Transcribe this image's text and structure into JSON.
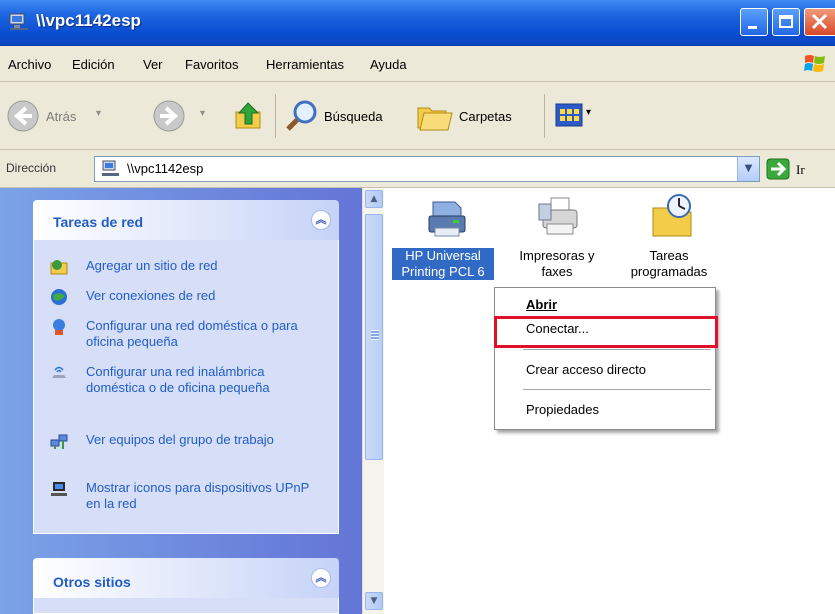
{
  "window": {
    "title": "\\\\vpc1142esp",
    "buttons": {
      "minimize": "_",
      "maximize": "□",
      "close": "✕"
    }
  },
  "menubar": {
    "items": [
      "Archivo",
      "Edición",
      "Ver",
      "Favoritos",
      "Herramientas",
      "Ayuda"
    ]
  },
  "toolbar": {
    "back_label": "Atrás",
    "search_label": "Búsqueda",
    "folders_label": "Carpetas"
  },
  "address": {
    "label": "Dirección",
    "value": "\\\\vpc1142esp",
    "go_label": "Ir"
  },
  "taskpane": {
    "network_tasks": {
      "title": "Tareas de red",
      "items": [
        {
          "label": "Agregar un sitio de red",
          "icon": "add-network-place-icon"
        },
        {
          "label": "Ver conexiones de red",
          "icon": "network-connections-icon"
        },
        {
          "label": "Configurar una red doméstica o para oficina pequeña",
          "icon": "home-network-icon"
        },
        {
          "label": "Configurar una red inalámbrica doméstica o de oficina pequeña",
          "icon": "wireless-network-icon"
        },
        {
          "label": "Ver equipos del grupo de trabajo",
          "icon": "workgroup-icon"
        },
        {
          "label": "Mostrar iconos para dispositivos UPnP en la red",
          "icon": "upnp-icon"
        }
      ]
    },
    "other_places": {
      "title": "Otros sitios"
    }
  },
  "content": {
    "items": [
      {
        "label_line1": "HP Universal",
        "label_line2": "Printing PCL 6",
        "icon": "printer-icon",
        "selected": true
      },
      {
        "label_line1": "Impresoras y",
        "label_line2": "faxes",
        "icon": "printers-faxes-icon",
        "selected": false
      },
      {
        "label_line1": "Tareas",
        "label_line2": "programadas",
        "icon": "scheduled-tasks-icon",
        "selected": false
      }
    ]
  },
  "context_menu": {
    "open": "Abrir",
    "connect": "Conectar...",
    "create_shortcut": "Crear acceso directo",
    "properties": "Propiedades",
    "highlight_color": "#e0102a"
  }
}
